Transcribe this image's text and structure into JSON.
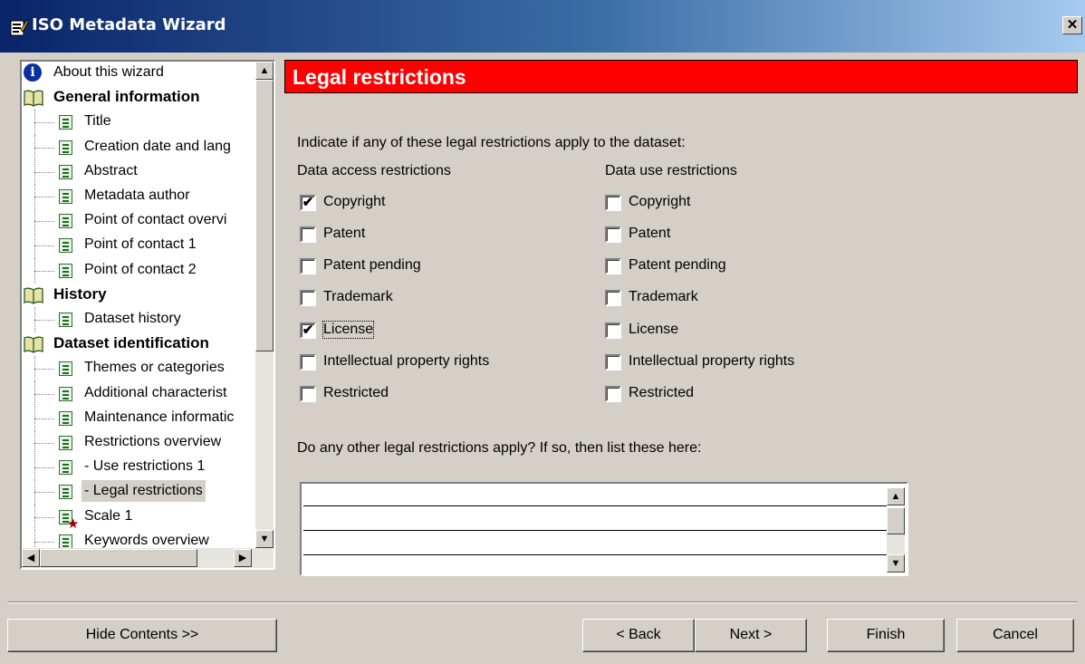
{
  "window": {
    "title": "ISO Metadata Wizard",
    "close_glyph": "✕"
  },
  "tree": {
    "items": [
      {
        "label": "About this wizard",
        "icon": "info-icon",
        "level": 0,
        "bold": false
      },
      {
        "label": "General information",
        "icon": "book-icon",
        "level": 0,
        "bold": true
      },
      {
        "label": "Title",
        "icon": "page-icon",
        "level": 1,
        "bold": false
      },
      {
        "label": "Creation date and lang",
        "icon": "page-icon",
        "level": 1,
        "bold": false
      },
      {
        "label": "Abstract",
        "icon": "page-icon",
        "level": 1,
        "bold": false
      },
      {
        "label": "Metadata author",
        "icon": "page-icon",
        "level": 1,
        "bold": false
      },
      {
        "label": "Point of contact overvi",
        "icon": "page-icon",
        "level": 1,
        "bold": false
      },
      {
        "label": "Point of contact 1",
        "icon": "page-icon",
        "level": 1,
        "bold": false
      },
      {
        "label": "Point of contact 2",
        "icon": "page-icon",
        "level": 1,
        "bold": false
      },
      {
        "label": "History",
        "icon": "book-icon",
        "level": 0,
        "bold": true
      },
      {
        "label": "Dataset history",
        "icon": "page-icon",
        "level": 1,
        "bold": false
      },
      {
        "label": "Dataset identification",
        "icon": "book-icon",
        "level": 0,
        "bold": true
      },
      {
        "label": "Themes or categories",
        "icon": "page-icon",
        "level": 1,
        "bold": false
      },
      {
        "label": "Additional characterist",
        "icon": "page-icon",
        "level": 1,
        "bold": false
      },
      {
        "label": "Maintenance informatic",
        "icon": "page-icon",
        "level": 1,
        "bold": false
      },
      {
        "label": "Restrictions overview",
        "icon": "page-icon",
        "level": 1,
        "bold": false
      },
      {
        "label": "- Use restrictions 1",
        "icon": "page-icon",
        "level": 1,
        "bold": false
      },
      {
        "label": "- Legal restrictions",
        "icon": "page-icon",
        "level": 1,
        "bold": false,
        "selected": true
      },
      {
        "label": "Scale 1",
        "icon": "page-required-icon",
        "level": 1,
        "bold": false
      },
      {
        "label": "Keywords overview",
        "icon": "page-icon",
        "level": 1,
        "bold": false
      }
    ]
  },
  "main": {
    "header": "Legal restrictions",
    "intro": "Indicate if any of these legal restrictions apply to the dataset:",
    "access_heading": "Data access restrictions",
    "use_heading": "Data use restrictions",
    "access_options": [
      {
        "label": "Copyright",
        "checked": true
      },
      {
        "label": "Patent",
        "checked": false
      },
      {
        "label": "Patent pending",
        "checked": false
      },
      {
        "label": "Trademark",
        "checked": false
      },
      {
        "label": "License",
        "checked": true,
        "focused": true
      },
      {
        "label": "Intellectual property rights",
        "checked": false
      },
      {
        "label": "Restricted",
        "checked": false
      }
    ],
    "use_options": [
      {
        "label": "Copyright",
        "checked": false
      },
      {
        "label": "Patent",
        "checked": false
      },
      {
        "label": "Patent pending",
        "checked": false
      },
      {
        "label": "Trademark",
        "checked": false
      },
      {
        "label": "License",
        "checked": false
      },
      {
        "label": "Intellectual property rights",
        "checked": false
      },
      {
        "label": "Restricted",
        "checked": false
      }
    ],
    "other_prompt": "Do any other legal restrictions apply?  If so, then list these here:"
  },
  "footer": {
    "hide_contents": "Hide Contents >>",
    "back": "< Back",
    "next": "Next >",
    "finish": "Finish",
    "cancel": "Cancel"
  },
  "glyphs": {
    "check": "✔",
    "up": "▲",
    "down": "▼",
    "left": "◀",
    "right": "▶"
  }
}
